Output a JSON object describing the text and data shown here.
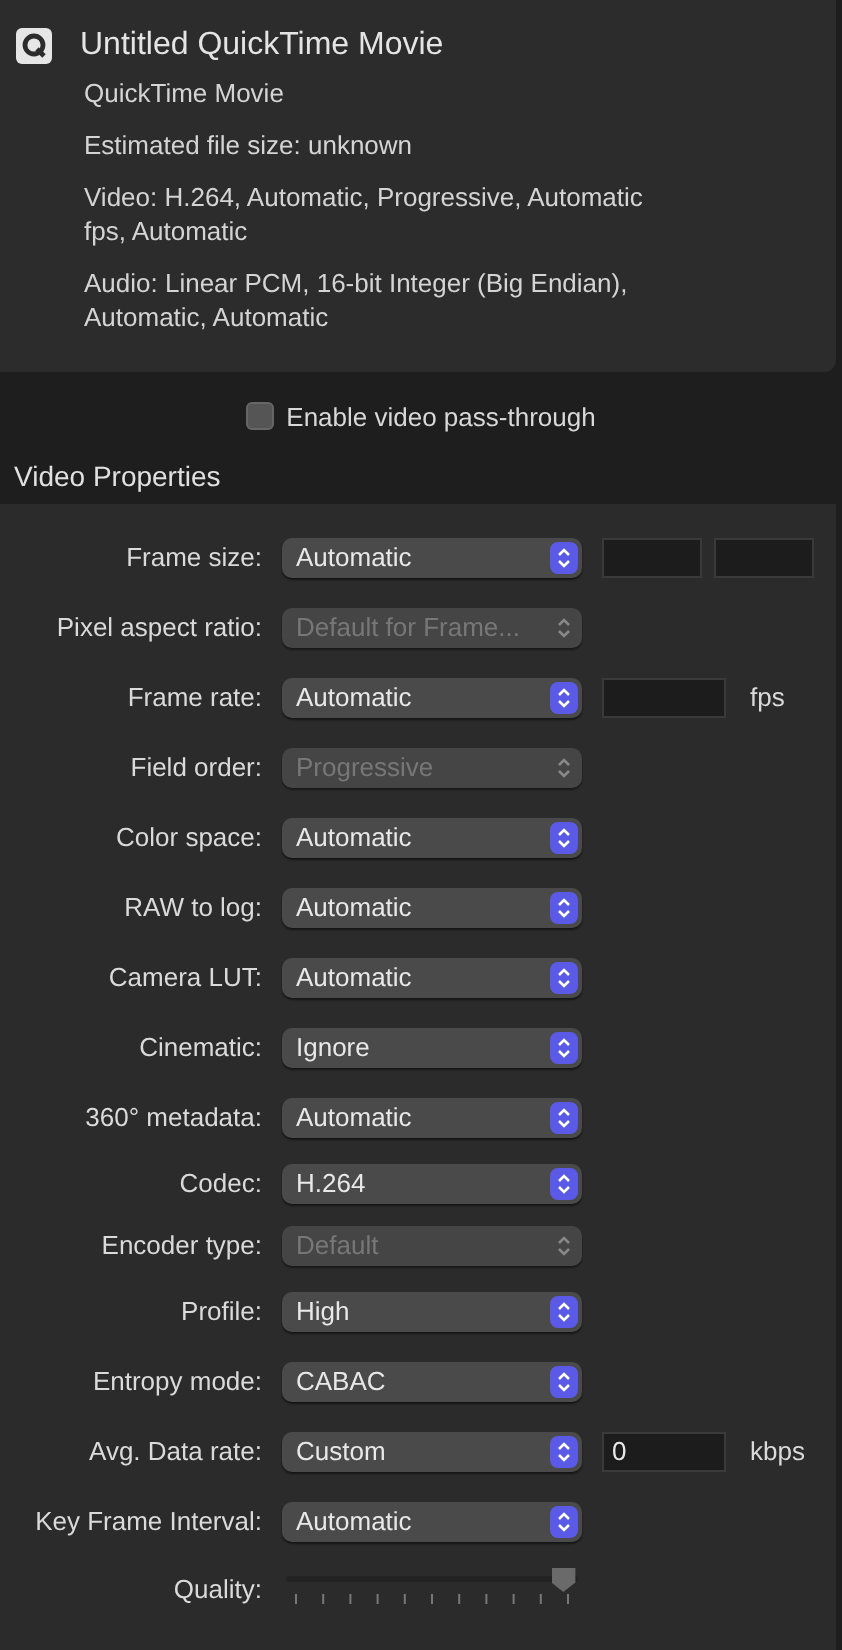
{
  "summary": {
    "title": "Untitled QuickTime Movie",
    "lines": [
      "QuickTime Movie",
      "Estimated file size: unknown",
      "Video: H.264, Automatic, Progressive, Automatic fps, Automatic",
      "Audio: Linear PCM, 16-bit Integer (Big Endian), Automatic, Automatic"
    ]
  },
  "pass_through": {
    "label": "Enable video pass-through",
    "checked": false
  },
  "section_title": "Video Properties",
  "properties": [
    {
      "kind": "select",
      "label": "Frame size:",
      "value": "Automatic",
      "disabled": false,
      "fields": [
        {
          "kind": "input"
        },
        {
          "kind": "input"
        }
      ]
    },
    {
      "kind": "select",
      "label": "Pixel aspect ratio:",
      "value": "Default for Frame...",
      "disabled": true
    },
    {
      "kind": "select",
      "label": "Frame rate:",
      "value": "Automatic",
      "disabled": false,
      "fields": [
        {
          "kind": "wide_input"
        }
      ],
      "unit": "fps"
    },
    {
      "kind": "select",
      "label": "Field order:",
      "value": "Progressive",
      "disabled": true
    },
    {
      "kind": "select",
      "label": "Color space:",
      "value": "Automatic",
      "disabled": false
    },
    {
      "kind": "select",
      "label": "RAW to log:",
      "value": "Automatic",
      "disabled": false
    },
    {
      "kind": "select",
      "label": "Camera LUT:",
      "value": "Automatic",
      "disabled": false
    },
    {
      "kind": "select",
      "label": "Cinematic:",
      "value": "Ignore",
      "disabled": false
    },
    {
      "kind": "select",
      "label": "360° metadata:",
      "value": "Automatic",
      "disabled": false
    },
    {
      "kind": "select",
      "label": "Codec:",
      "value": "H.264",
      "disabled": false
    },
    {
      "kind": "select",
      "label": "Encoder type:",
      "value": "Default",
      "disabled": true
    },
    {
      "kind": "select",
      "label": "Profile:",
      "value": "High",
      "disabled": false
    },
    {
      "kind": "select",
      "label": "Entropy mode:",
      "value": "CABAC",
      "disabled": false
    },
    {
      "kind": "select",
      "label": "Avg. Data rate:",
      "value": "Custom",
      "disabled": false,
      "fields": [
        {
          "kind": "wide_input",
          "value": "0"
        }
      ],
      "unit": "kbps"
    },
    {
      "kind": "select",
      "label": "Key Frame Interval:",
      "value": "Automatic",
      "disabled": false
    },
    {
      "kind": "slider",
      "label": "Quality:",
      "level": 0.95
    }
  ]
}
